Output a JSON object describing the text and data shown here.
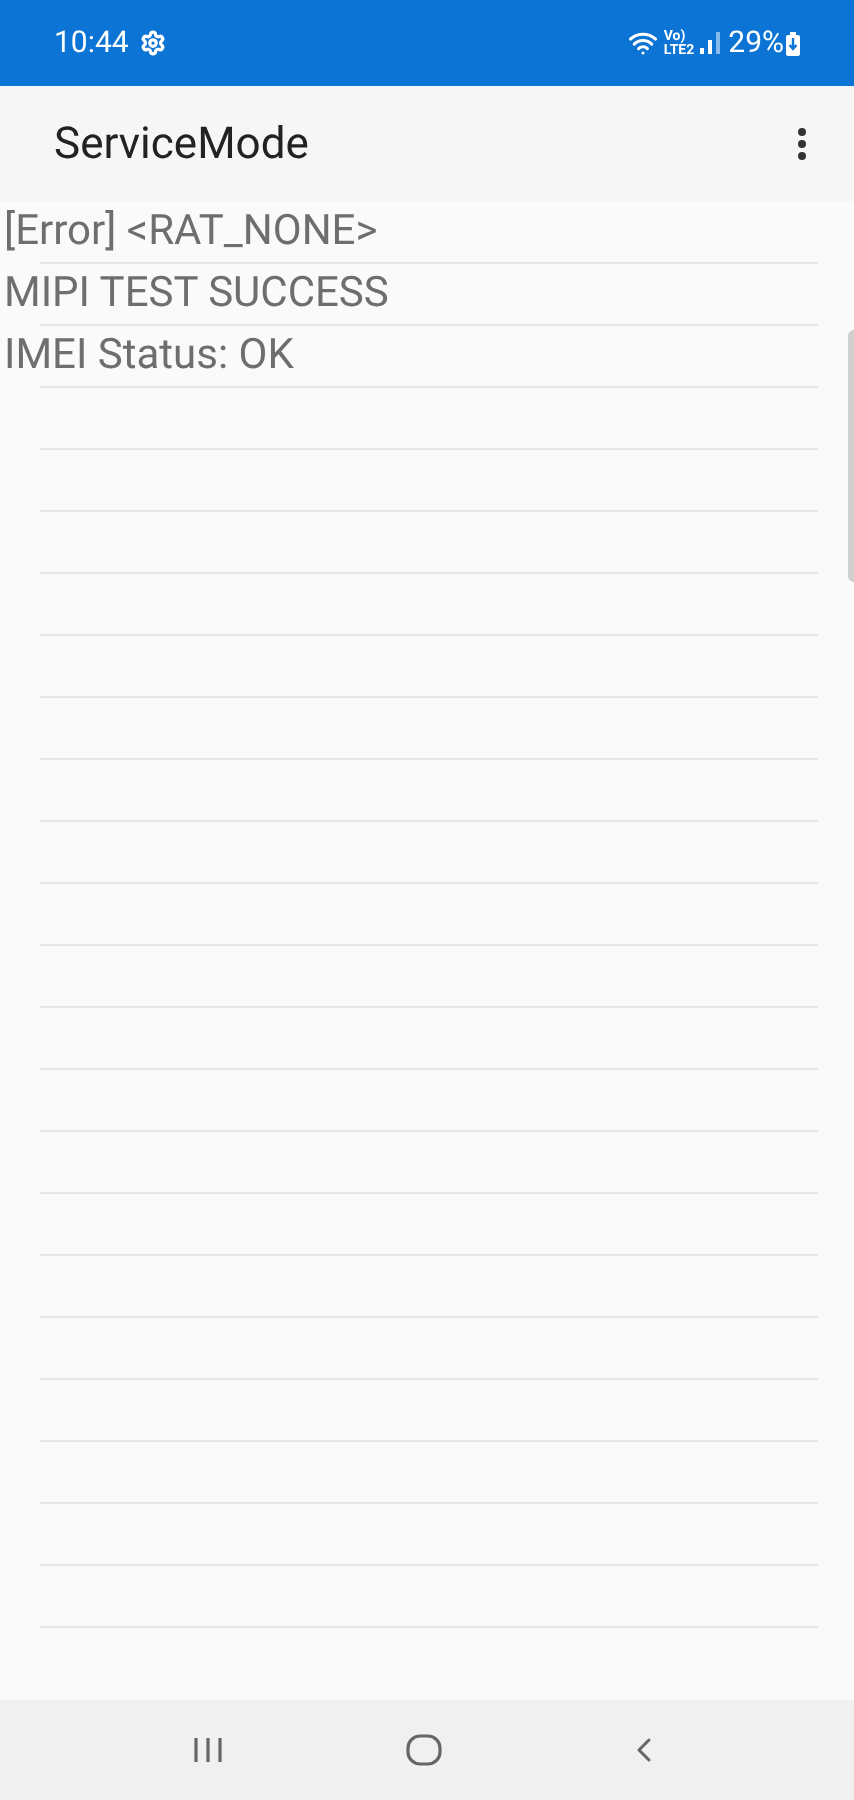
{
  "status_bar": {
    "time": "10:44",
    "network_top": "Vo)",
    "network_bottom": "LTE2",
    "battery": "29%"
  },
  "app_bar": {
    "title": "ServiceMode"
  },
  "lines": [
    "[Error] <RAT_NONE>",
    "MIPI TEST SUCCESS",
    "IMEI Status: OK"
  ]
}
